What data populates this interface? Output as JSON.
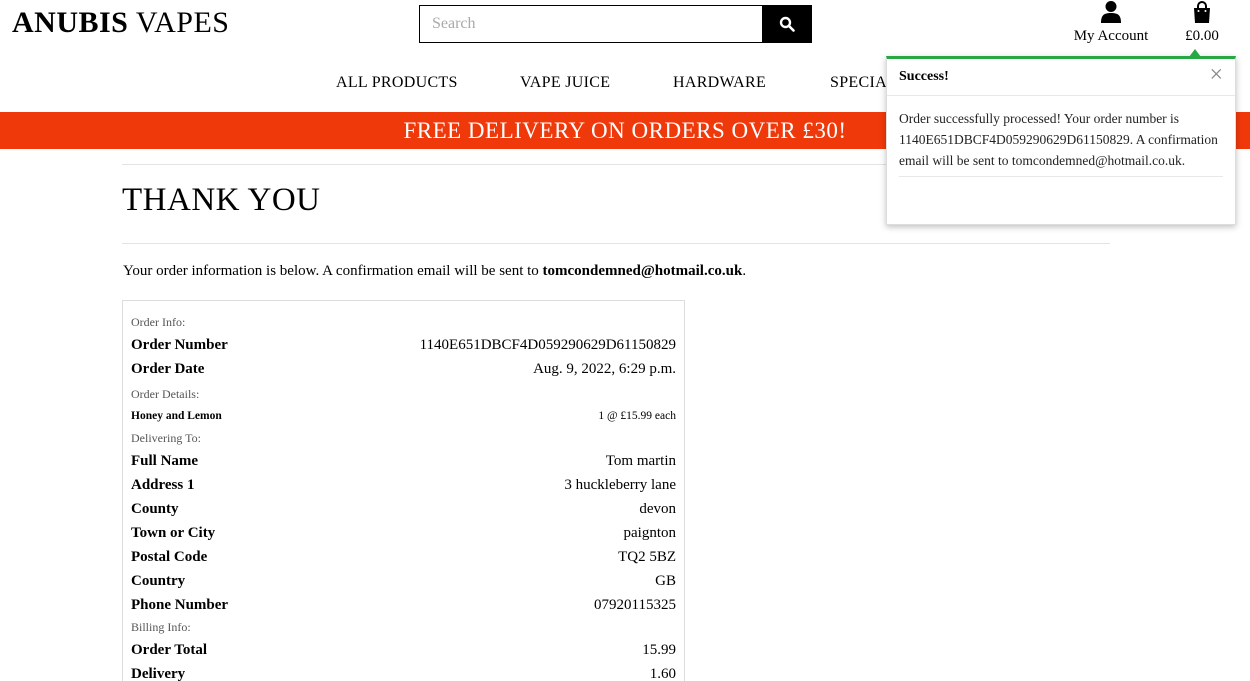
{
  "header": {
    "logo_bold": "ANUBIS",
    "logo_rest": " VAPES",
    "search_placeholder": "Search",
    "account_label": "My Account",
    "cart_total": "£0.00"
  },
  "nav": {
    "items": [
      "ALL PRODUCTS",
      "VAPE JUICE",
      "HARDWARE",
      "SPECIA"
    ]
  },
  "banner": "FREE DELIVERY ON ORDERS OVER £30!",
  "page": {
    "title": "THANK YOU",
    "intro_text": "Your order information is below. A confirmation email will be sent to ",
    "email": "tomcondemned@hotmail.co.uk",
    "intro_end": "."
  },
  "order": {
    "info_label": "Order Info:",
    "number_key": "Order Number",
    "number_val": "1140E651DBCF4D059290629D61150829",
    "date_key": "Order Date",
    "date_val": "Aug. 9, 2022, 6:29 p.m.",
    "details_label": "Order Details:",
    "item_name": "Honey and Lemon",
    "item_qty": "1 @ £15.99 each",
    "delivering_label": "Delivering To:",
    "fullname_key": "Full Name",
    "fullname_val": "Tom martin",
    "address_key": "Address 1",
    "address_val": "3 huckleberry lane",
    "county_key": "County",
    "county_val": "devon",
    "town_key": "Town or City",
    "town_val": "paignton",
    "postal_key": "Postal Code",
    "postal_val": "TQ2 5BZ",
    "country_key": "Country",
    "country_val": "GB",
    "phone_key": "Phone Number",
    "phone_val": "07920115325",
    "billing_label": "Billing Info:",
    "total_key": "Order Total",
    "total_val": "15.99",
    "delivery_key": "Delivery",
    "delivery_val": "1.60"
  },
  "toast": {
    "title": "Success!",
    "close": "×",
    "message": "Order successfully processed! Your order number is 1140E651DBCF4D059290629D61150829. A confirmation email will be sent to tomcondemned@hotmail.co.uk."
  },
  "colors": {
    "banner": "#f0390b",
    "toast_accent": "#28a745"
  }
}
